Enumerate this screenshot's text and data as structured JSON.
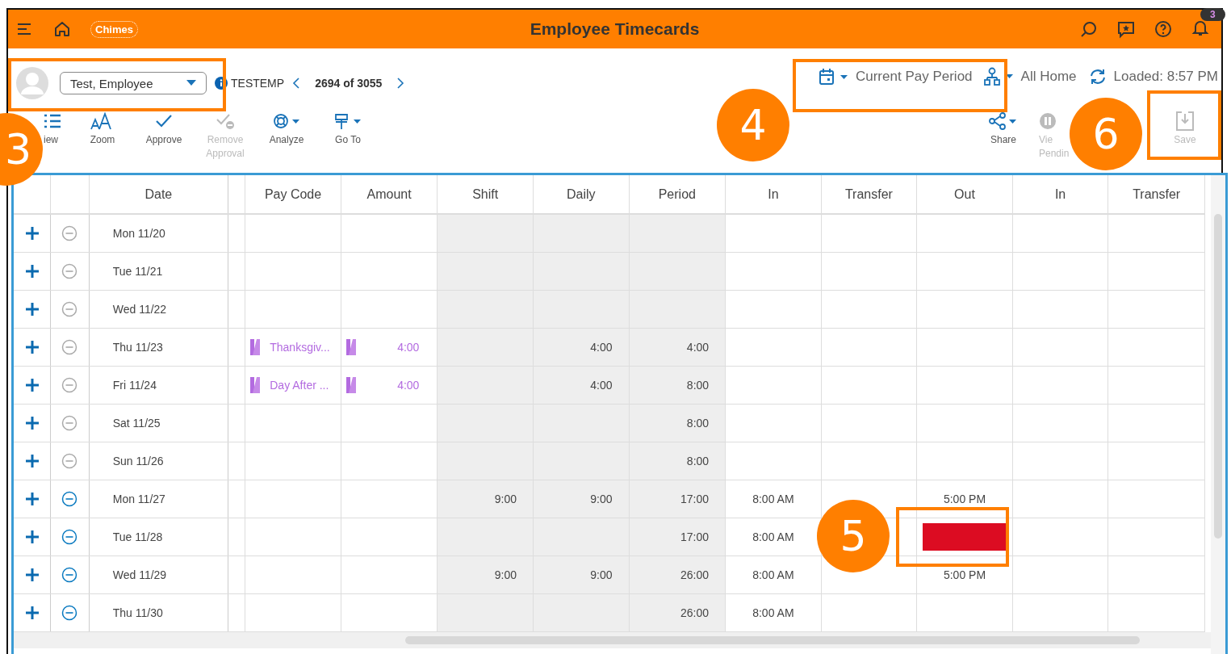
{
  "header": {
    "logo_text": "Chimes",
    "title": "Employee Timecards",
    "notification_count": "3"
  },
  "employee": {
    "name": "Test, Employee",
    "code": "TESTEMP",
    "position": "2694 of 3055"
  },
  "period": {
    "label": "Current Pay Period",
    "location": "All Home",
    "loaded": "Loaded: 8:57 PM"
  },
  "toolbar_left": [
    {
      "kind": "list",
      "lines": [
        "iew"
      ],
      "disabled": false
    },
    {
      "kind": "zoom",
      "lines": [
        "Zoom"
      ],
      "disabled": false
    },
    {
      "kind": "check",
      "lines": [
        "Approve"
      ],
      "disabled": false
    },
    {
      "kind": "uncheck",
      "lines": [
        "Remove",
        "Approval"
      ],
      "disabled": true
    },
    {
      "kind": "analyze",
      "lines": [
        "Analyze"
      ],
      "disabled": false
    },
    {
      "kind": "goto",
      "lines": [
        "Go To"
      ],
      "disabled": false
    }
  ],
  "toolbar_right": [
    {
      "kind": "share",
      "lines": [
        "Share"
      ],
      "disabled": false
    },
    {
      "kind": "pause",
      "lines": [
        "Vie",
        "Pendin"
      ],
      "disabled": true
    },
    {
      "kind": "save",
      "lines": [
        "Save"
      ],
      "disabled": true
    }
  ],
  "table": {
    "columns": [
      "Date",
      "Pay Code",
      "Amount",
      "Shift",
      "Daily",
      "Period",
      "In",
      "Transfer",
      "Out",
      "In",
      "Transfer"
    ],
    "rows": [
      {
        "date": "Mon 11/20",
        "remove_enabled": false,
        "pay_code": "",
        "amount": "",
        "shift": "",
        "daily": "",
        "period": "",
        "in_1": "",
        "out": "",
        "out_redacted": false
      },
      {
        "date": "Tue 11/21",
        "remove_enabled": false,
        "pay_code": "",
        "amount": "",
        "shift": "",
        "daily": "",
        "period": "",
        "in_1": "",
        "out": "",
        "out_redacted": false
      },
      {
        "date": "Wed 11/22",
        "remove_enabled": false,
        "pay_code": "",
        "amount": "",
        "shift": "",
        "daily": "",
        "period": "",
        "in_1": "",
        "out": "",
        "out_redacted": false
      },
      {
        "date": "Thu 11/23",
        "remove_enabled": false,
        "pay_code": "Thanksgiv...",
        "amount": "4:00",
        "shift": "",
        "daily": "4:00",
        "period": "4:00",
        "in_1": "",
        "out": "",
        "out_redacted": false
      },
      {
        "date": "Fri 11/24",
        "remove_enabled": false,
        "pay_code": "Day After ...",
        "amount": "4:00",
        "shift": "",
        "daily": "4:00",
        "period": "8:00",
        "in_1": "",
        "out": "",
        "out_redacted": false
      },
      {
        "date": "Sat 11/25",
        "remove_enabled": false,
        "pay_code": "",
        "amount": "",
        "shift": "",
        "daily": "",
        "period": "8:00",
        "in_1": "",
        "out": "",
        "out_redacted": false
      },
      {
        "date": "Sun 11/26",
        "remove_enabled": false,
        "pay_code": "",
        "amount": "",
        "shift": "",
        "daily": "",
        "period": "8:00",
        "in_1": "",
        "out": "",
        "out_redacted": false
      },
      {
        "date": "Mon 11/27",
        "remove_enabled": true,
        "pay_code": "",
        "amount": "",
        "shift": "9:00",
        "daily": "9:00",
        "period": "17:00",
        "in_1": "8:00 AM",
        "out": "5:00 PM",
        "out_redacted": false
      },
      {
        "date": "Tue 11/28",
        "remove_enabled": true,
        "pay_code": "",
        "amount": "",
        "shift": "",
        "daily": "",
        "period": "17:00",
        "in_1": "8:00 AM",
        "out": "",
        "out_redacted": true
      },
      {
        "date": "Wed 11/29",
        "remove_enabled": true,
        "pay_code": "",
        "amount": "",
        "shift": "9:00",
        "daily": "9:00",
        "period": "26:00",
        "in_1": "8:00 AM",
        "out": "5:00 PM",
        "out_redacted": false
      },
      {
        "date": "Thu 11/30",
        "remove_enabled": true,
        "pay_code": "",
        "amount": "",
        "shift": "",
        "daily": "",
        "period": "26:00",
        "in_1": "8:00 AM",
        "out": "",
        "out_redacted": false
      }
    ]
  },
  "callouts": [
    {
      "number": "3"
    },
    {
      "number": "4"
    },
    {
      "number": "5"
    },
    {
      "number": "6"
    }
  ]
}
